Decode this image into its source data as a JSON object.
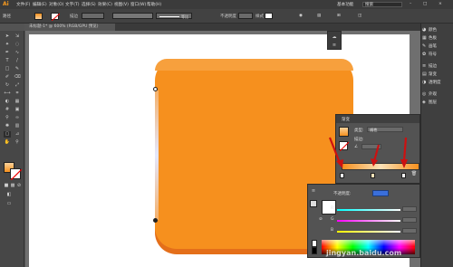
{
  "app": {
    "logo": "Ai"
  },
  "menubar": {
    "items": [
      "文件(F)",
      "编辑(E)",
      "对象(O)",
      "文字(T)",
      "选择(S)",
      "效果(C)",
      "视图(V)",
      "窗口(W)",
      "帮助(H)"
    ],
    "workspace": "基本功能",
    "search": "搜索"
  },
  "ctrlbar": {
    "label_path": "路径",
    "label_stroke": "描边",
    "stroke_value": "",
    "brush_label": "等比",
    "opacity_label": "不透明度",
    "style_label": "样式"
  },
  "document": {
    "tab": "未标题-1* @ 600% (RGB/GPU 预览)"
  },
  "right_panel": {
    "items": [
      {
        "icon": "color-icon",
        "label": "颜色"
      },
      {
        "icon": "swatches-icon",
        "label": "色板"
      },
      {
        "icon": "brush-icon",
        "label": "画笔"
      },
      {
        "icon": "symbol-icon",
        "label": "符号"
      },
      {
        "icon": "stroke-icon",
        "label": "描边"
      },
      {
        "icon": "gradient-icon",
        "label": "渐变"
      },
      {
        "icon": "transparency-icon",
        "label": "透明度"
      },
      {
        "icon": "appearance-icon",
        "label": "外观"
      },
      {
        "icon": "layers-icon",
        "label": "图层"
      }
    ]
  },
  "gradient_panel": {
    "title": "渐变",
    "type_label": "类型:",
    "type_value": "线性",
    "stroke_label": "描边:",
    "angle_label": "∠",
    "angle_value": "",
    "stops": [
      0,
      0.5,
      1
    ]
  },
  "color_panel": {
    "opacity_label": "不透明度:",
    "hex_value": "",
    "channels": [
      {
        "name": "R",
        "value": ""
      },
      {
        "name": "G",
        "value": ""
      },
      {
        "name": "B",
        "value": ""
      }
    ]
  },
  "colors": {
    "shape_fill": "#f6901e",
    "shape_shadow": "#e46f1a",
    "accent_arrow": "#cc1111"
  },
  "watermark": "jingyan.baidu.com"
}
